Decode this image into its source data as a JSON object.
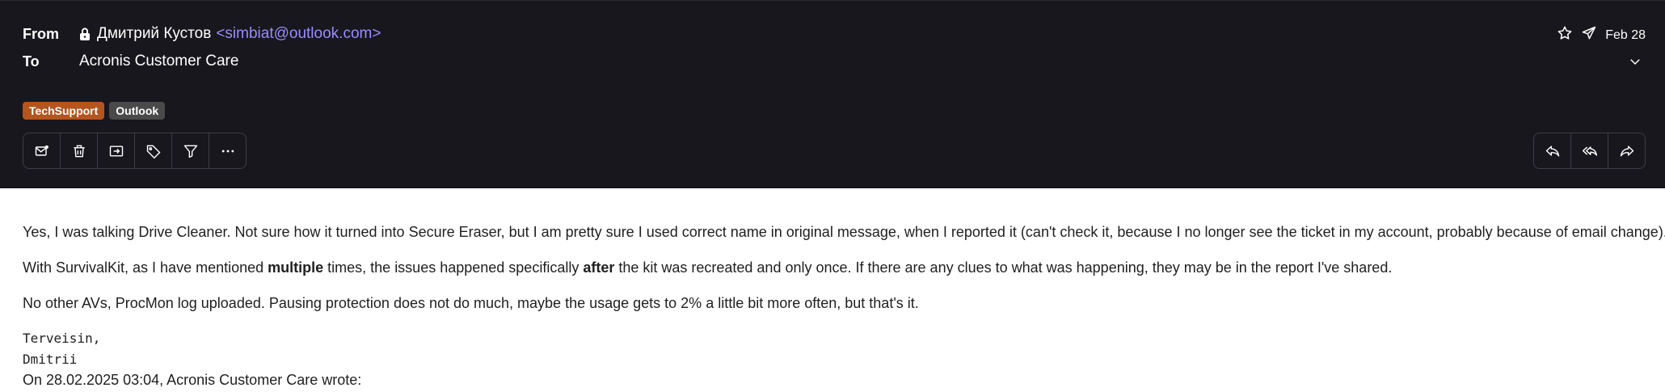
{
  "header": {
    "from_label": "From",
    "from_name": "Дмитрий Кустов",
    "from_email": "<simbiat@outlook.com>",
    "to_label": "To",
    "to_name": "Acronis Customer Care",
    "date": "Feb 28"
  },
  "tags": [
    {
      "label": "TechSupport",
      "color": "#b5541d"
    },
    {
      "label": "Outlook",
      "color": "#4a4a4a"
    }
  ],
  "toolbar": {
    "left": [
      "mark-unread-icon",
      "trash-icon",
      "move-to-folder-icon",
      "tag-icon",
      "filter-icon",
      "more-icon"
    ],
    "right": [
      "reply-icon",
      "reply-all-icon",
      "forward-icon"
    ]
  },
  "message": {
    "p1": "Yes, I was talking Drive Cleaner. Not sure how it turned into Secure Eraser, but I am pretty sure I used correct name in original message, when I reported it (can't check it, because I no longer see the ticket in my account, probably because of email change).",
    "p2_a": "With SurvivalKit, as I have mentioned ",
    "p2_b": "multiple",
    "p2_c": " times, the issues happened specifically ",
    "p2_d": "after",
    "p2_e": " the kit was recreated and only once. If there are any clues to what was happening, they may be in the report I've shared.",
    "p3": "No other AVs, ProcMon log uploaded. Pausing protection does not do much, maybe the usage gets to 2% a little bit more often, but that's it.",
    "sign1": "Terveisin,",
    "sign2": "Dmitrii",
    "quote_header": "On 28.02.2025 03:04, Acronis Customer Care wrote:"
  },
  "colors": {
    "header_bg": "#17171d",
    "email_link": "#9a8cff",
    "border": "#3d3d45"
  }
}
